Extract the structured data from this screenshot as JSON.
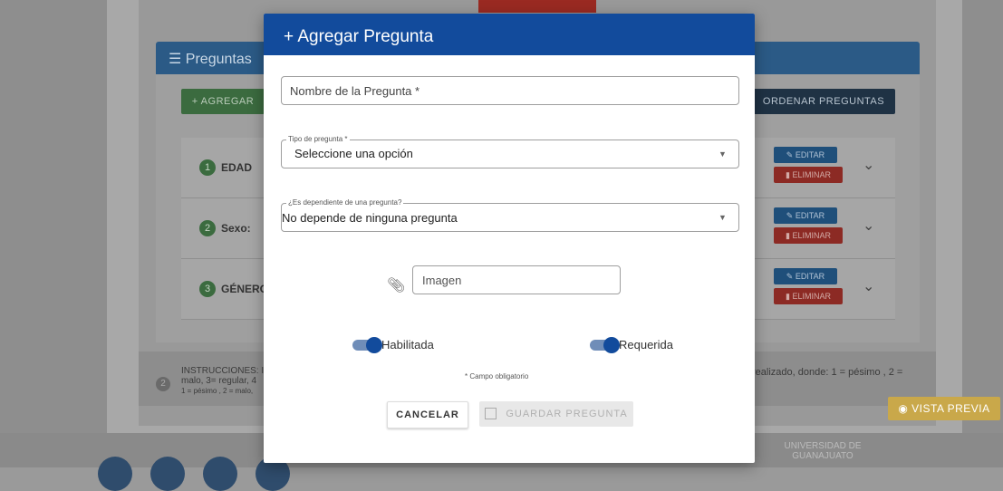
{
  "background": {
    "section_title": "Preguntas",
    "add_button": "+ AGREGAR",
    "order_button": "ORDENAR PREGUNTAS",
    "questions": [
      {
        "num": "1",
        "label": "EDAD"
      },
      {
        "num": "2",
        "label": "Sexo:"
      },
      {
        "num": "3",
        "label": "GÉNERO"
      }
    ],
    "edit_label": "EDITAR",
    "delete_label": "ELIMINAR",
    "instructions_num": "2",
    "instructions_left_1": "INSTRUCCIONES: I",
    "instructions_left_2": "malo, 3= regular, 4",
    "instructions_left_3": "1 = pésimo , 2 = malo,",
    "instructions_right": "realizado, donde: 1 = pésimo , 2 =",
    "preview_button": "VISTA PREVIA",
    "university_line1": "UNIVERSIDAD DE",
    "university_line2": "GUANAJUATO"
  },
  "modal": {
    "title": "+ Agregar Pregunta",
    "name_placeholder": "Nombre de la Pregunta *",
    "type_legend": "Tipo de pregunta *",
    "type_value": "Seleccione una opción",
    "dependent_legend": "¿Es dependiente de una pregunta?",
    "dependent_value": "No depende de ninguna pregunta",
    "image_placeholder": "Imagen",
    "toggle_enabled_label": "Habilitada",
    "toggle_required_label": "Requerida",
    "required_note": "* Campo obligatorio",
    "cancel_button": "CANCELAR",
    "save_button": "GUARDAR PREGUNTA"
  },
  "colors": {
    "modal_header": "#124b9c",
    "toggle": "#124b9c",
    "preview_button": "#c9a84a"
  }
}
